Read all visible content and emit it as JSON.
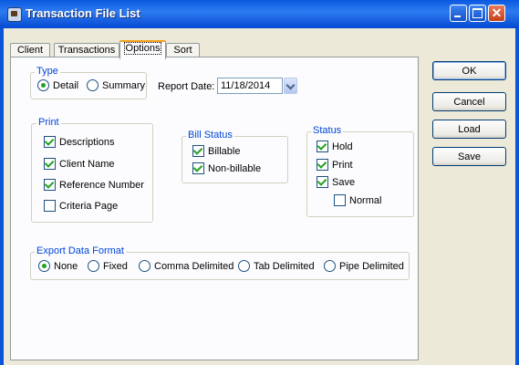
{
  "window": {
    "title": "Transaction File List"
  },
  "tabs": [
    {
      "label": "Client"
    },
    {
      "label": "Transactions"
    },
    {
      "label": "Options"
    },
    {
      "label": "Sort"
    }
  ],
  "type_group": {
    "title": "Type",
    "options": [
      {
        "label": "Detail",
        "selected": true
      },
      {
        "label": "Summary",
        "selected": false
      }
    ]
  },
  "report_date": {
    "label": "Report Date:",
    "value": "11/18/2014"
  },
  "print_group": {
    "title": "Print",
    "items": [
      {
        "label": "Descriptions",
        "checked": true
      },
      {
        "label": "Client Name",
        "checked": true
      },
      {
        "label": "Reference Number",
        "checked": true
      },
      {
        "label": "Criteria Page",
        "checked": false
      }
    ]
  },
  "bill_status_group": {
    "title": "Bill Status",
    "items": [
      {
        "label": "Billable",
        "checked": true
      },
      {
        "label": "Non-billable",
        "checked": true
      }
    ]
  },
  "status_group": {
    "title": "Status",
    "items": [
      {
        "label": "Hold",
        "checked": true
      },
      {
        "label": "Print",
        "checked": true
      },
      {
        "label": "Save",
        "checked": true
      },
      {
        "label": "Normal",
        "checked": false
      }
    ]
  },
  "export_group": {
    "title": "Export Data Format",
    "options": [
      {
        "label": "None",
        "selected": true
      },
      {
        "label": "Fixed",
        "selected": false
      },
      {
        "label": "Comma Delimited",
        "selected": false
      },
      {
        "label": "Tab Delimited",
        "selected": false
      },
      {
        "label": "Pipe Delimited",
        "selected": false
      }
    ]
  },
  "buttons": {
    "ok": "OK",
    "cancel": "Cancel",
    "load": "Load",
    "save": "Save"
  }
}
